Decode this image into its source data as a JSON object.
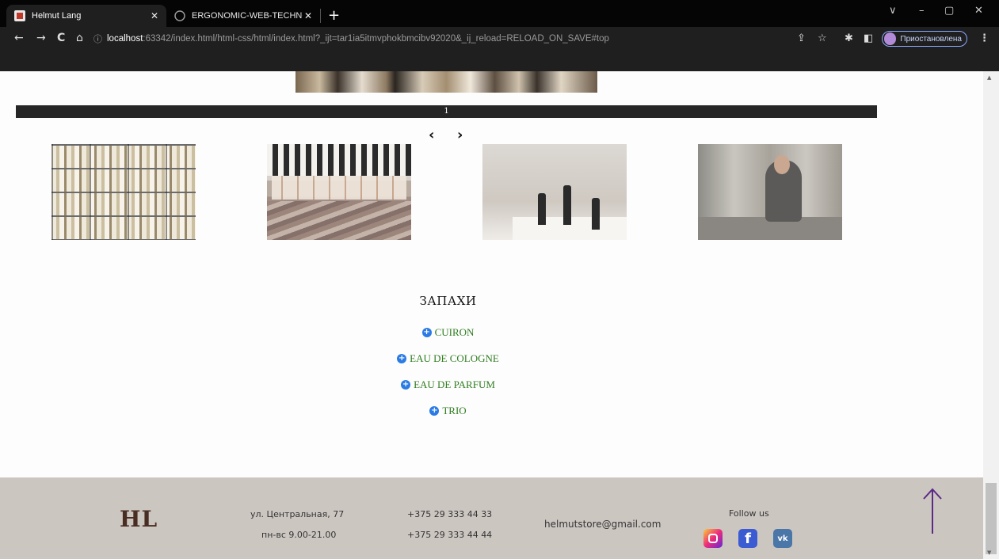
{
  "browser": {
    "tabs": [
      {
        "title": "Helmut Lang",
        "active": true
      },
      {
        "title": "ERGONOMIC-WEB-TECHNOLOG",
        "active": false
      }
    ],
    "url_info_icon": "ⓘ",
    "url_host": "localhost",
    "url_rest": ":63342/index.html/html-css/html/index.html?_ijt=tar1ia5itmvphokbmcibv92020&_ij_reload=RELOAD_ON_SAVE#top",
    "profile_label": "Приостановлена",
    "new_tab": "+",
    "nav_back": "←",
    "nav_forward": "→",
    "nav_reload": "C",
    "nav_home": "⌂",
    "win_chevron": "∨",
    "win_minimize": "–",
    "win_maximize": "▢",
    "win_close": "✕",
    "tab_close": "✕",
    "toolbar_icons": {
      "share": "⇪",
      "star": "☆",
      "extensions": "✱",
      "sidepanel": "◧",
      "menu": "⋮"
    }
  },
  "slider": {
    "counter": "1",
    "prev": "‹",
    "next": "›"
  },
  "gallery": [
    {
      "name": "perfume-shelves"
    },
    {
      "name": "piano-keys-vials"
    },
    {
      "name": "roller-bottles"
    },
    {
      "name": "woman-testing-perfume"
    }
  ],
  "scents": {
    "title": "ЗАПАХИ",
    "items": [
      "CUIRON",
      "EAU DE COLOGNE",
      "EAU DE PARFUM",
      "TRIO"
    ],
    "plus_symbol": "+"
  },
  "footer": {
    "logo": "HL",
    "address": "ул. Центральная, 77",
    "hours": "пн-вс 9.00-21.00",
    "phone1": "+375 29 333 44 33",
    "phone2": "+375 29 333 44 44",
    "email": "helmutstore@gmail.com",
    "follow": "Follow us",
    "fb_letter": "f",
    "vk_letters": "vk",
    "accent_color": "#5b2a86"
  }
}
